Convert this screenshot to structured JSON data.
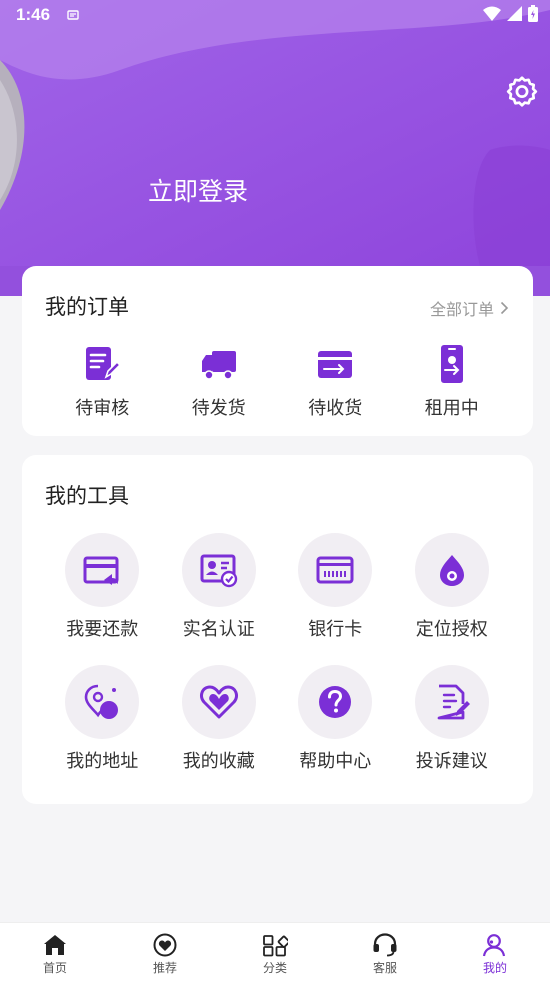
{
  "status_bar": {
    "time": "1:46"
  },
  "header": {
    "login_label": "立即登录"
  },
  "orders": {
    "title": "我的订单",
    "all_label": "全部订单",
    "items": [
      {
        "label": "待审核",
        "icon": "pending-review-icon"
      },
      {
        "label": "待发货",
        "icon": "truck-icon"
      },
      {
        "label": "待收货",
        "icon": "receive-card-icon"
      },
      {
        "label": "租用中",
        "icon": "phone-rent-icon"
      }
    ]
  },
  "tools": {
    "title": "我的工具",
    "items": [
      {
        "label": "我要还款",
        "icon": "repay-icon"
      },
      {
        "label": "实名认证",
        "icon": "id-verify-icon"
      },
      {
        "label": "银行卡",
        "icon": "bank-card-icon"
      },
      {
        "label": "定位授权",
        "icon": "location-icon"
      },
      {
        "label": "我的地址",
        "icon": "address-icon"
      },
      {
        "label": "我的收藏",
        "icon": "heart-icon"
      },
      {
        "label": "帮助中心",
        "icon": "help-icon"
      },
      {
        "label": "投诉建议",
        "icon": "feedback-icon"
      }
    ]
  },
  "bottom_nav": {
    "items": [
      {
        "label": "首页",
        "icon": "home-icon"
      },
      {
        "label": "推荐",
        "icon": "recommend-icon"
      },
      {
        "label": "分类",
        "icon": "category-icon"
      },
      {
        "label": "客服",
        "icon": "headset-icon"
      },
      {
        "label": "我的",
        "icon": "profile-icon",
        "active": true
      }
    ]
  },
  "colors": {
    "brand": "#7b2fd6",
    "header": "#9b55e0",
    "bg": "#f5f5f7"
  }
}
